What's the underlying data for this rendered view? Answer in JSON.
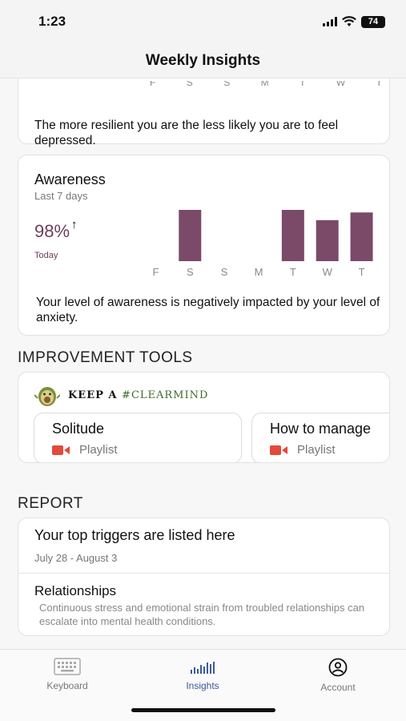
{
  "status_bar": {
    "time": "1:23",
    "battery": "74"
  },
  "header": {
    "title": "Weekly Insights"
  },
  "resilience_card": {
    "day_labels": [
      "F",
      "S",
      "S",
      "M",
      "T",
      "W",
      "T"
    ],
    "description": "The more resilient you are the less likely you are to feel depressed."
  },
  "awareness_card": {
    "title": "Awareness",
    "subtitle": "Last 7 days",
    "value": "98%",
    "value_caption": "Today",
    "trend_arrow": "↑",
    "description": "Your level of awareness is negatively impacted by your level of anxiety."
  },
  "chart_data": {
    "type": "bar",
    "categories": [
      "F",
      "S",
      "S",
      "M",
      "T",
      "W",
      "T"
    ],
    "values": [
      0,
      100,
      0,
      0,
      100,
      80,
      95
    ],
    "ylim": [
      0,
      100
    ],
    "bar_color": "#7a4a68"
  },
  "improvement_tools": {
    "section_title": "IMPROVEMENT TOOLS",
    "banner_text": "KEEP A",
    "banner_tag": "#CLEARMIND",
    "items": [
      {
        "name": "Solitude",
        "type": "Playlist",
        "icon": "video-icon"
      },
      {
        "name": "How to manage",
        "type": "Playlist",
        "icon": "video-icon"
      }
    ]
  },
  "report": {
    "section_title": "REPORT",
    "card_title": "Your top triggers are listed here",
    "date_range": "July 28 - August 3",
    "item_title": "Relationships",
    "item_description": "Continuous stress and emotional strain from troubled relationships can escalate into mental health conditions."
  },
  "tab_bar": {
    "tabs": [
      {
        "label": "Keyboard",
        "icon": "keyboard-icon"
      },
      {
        "label": "Insights",
        "icon": "insights-icon",
        "active": true
      },
      {
        "label": "Account",
        "icon": "account-icon"
      }
    ],
    "accent_color": "#3a5a9a"
  }
}
